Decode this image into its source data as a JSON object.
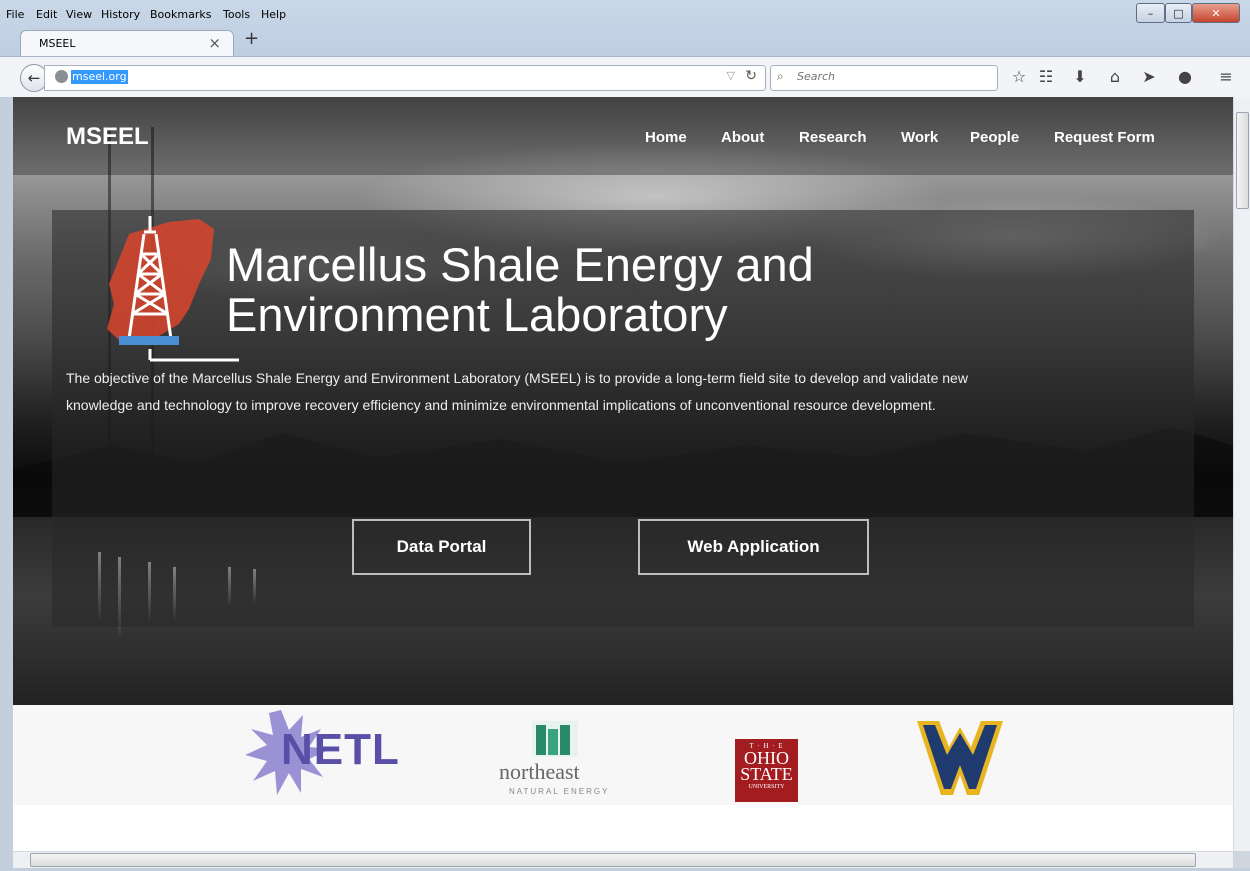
{
  "menubar": {
    "items": [
      "File",
      "Edit",
      "View",
      "History",
      "Bookmarks",
      "Tools",
      "Help"
    ]
  },
  "window_controls": {
    "minimize": "–",
    "maximize": "□",
    "close": "✕"
  },
  "tab": {
    "title": "MSEEL",
    "close": "×",
    "new_tab": "+"
  },
  "navbar": {
    "url": "mseel.org",
    "search_placeholder": "Search",
    "icons": [
      "star-icon",
      "reading-list-icon",
      "download-icon",
      "home-icon",
      "send-icon",
      "chat-icon",
      "menu-icon"
    ]
  },
  "site": {
    "logo": "MSEEL",
    "nav": [
      "Home",
      "About",
      "Research",
      "Work",
      "People",
      "Request Form"
    ],
    "hero": {
      "title_line1": "Marcellus Shale Energy and",
      "title_line2": "Environment Laboratory",
      "description": "The objective of the Marcellus Shale Energy and Environment Laboratory (MSEEL) is to provide a long-term field site to develop and validate new knowledge and technology to improve recovery efficiency and minimize environmental implications of unconventional resource development.",
      "buttons": [
        "Data Portal",
        "Web Application"
      ]
    },
    "partners": {
      "netl": "NETL",
      "northeast": "northeast",
      "northeast_sub": "NATURAL ENERGY",
      "osu_the": "T · H · E",
      "osu_line1": "OHIO",
      "osu_line2": "STATE",
      "osu_line3": "UNIVERSITY"
    }
  },
  "colors": {
    "accent_red": "#d9452b",
    "rig_blue": "#4a8fd4",
    "netl_purple": "#6b5fb3",
    "wvu_gold": "#e8b520",
    "wvu_navy": "#1e3a6e",
    "osu_red": "#a31c20",
    "northeast_green": "#2b8a6a"
  }
}
